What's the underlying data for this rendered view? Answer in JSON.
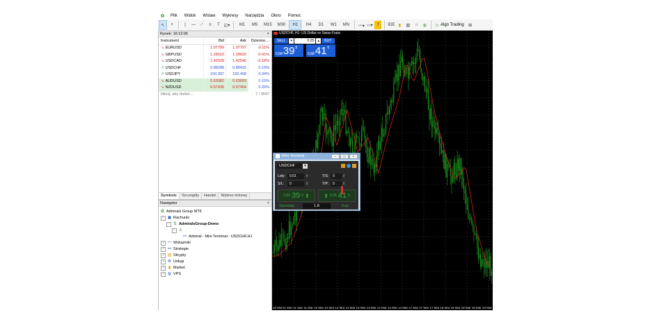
{
  "menu": [
    "Plik",
    "Widok",
    "Wstaw",
    "Wykresy",
    "Narzędzia",
    "Okno",
    "Pomoc"
  ],
  "toolbar": {
    "timeframes": [
      "M1",
      "M5",
      "M15",
      "M30",
      "H1",
      "H4",
      "D1",
      "W1",
      "MN"
    ],
    "active_timeframe": "H1",
    "algo_trading": "Algo Trading"
  },
  "market_watch": {
    "title": "Rynek: 16:12:06",
    "headers": [
      "Instrument",
      "Bid",
      "Ask",
      "Dzienna ..."
    ],
    "rows": [
      {
        "symbol": "EURUSD",
        "bid": "1.07789",
        "ask": "1.07797",
        "change": "-0.11%",
        "dir": "down"
      },
      {
        "symbol": "GBPUSD",
        "bid": "1.28910",
        "ask": "1.28920",
        "change": "-0.41%",
        "dir": "down"
      },
      {
        "symbol": "USDCAD",
        "bid": "1.42528",
        "ask": "1.42546",
        "change": "-0.18%",
        "dir": "down"
      },
      {
        "symbol": "USDCHF",
        "bid": "0.88398",
        "ask": "0.88416",
        "change": "0.19%",
        "dir": "up"
      },
      {
        "symbol": "USDJPY",
        "bid": "150.397",
        "ask": "150.408",
        "change": "0.34%",
        "dir": "up"
      },
      {
        "symbol": "AUDUSD",
        "bid": "0.63082",
        "ask": "0.63093",
        "change": "0.10%",
        "dir": "down"
      },
      {
        "symbol": "NZDUSD",
        "bid": "0.57435",
        "ask": "0.57454",
        "change": "0.20%",
        "dir": "down"
      }
    ],
    "add_label": "kliknij, aby dodać...",
    "count": "7 / 3597",
    "tabs": [
      "Symbole",
      "Szczegóły",
      "Handel",
      "Wykres tickowy"
    ]
  },
  "navigator": {
    "title": "Nawigator",
    "items": [
      "Admirals Group MT5",
      "Rachunki",
      "AdmiralsGroup-Demo",
      "Admiral - Mini Terminal - USDCHF,H1",
      "Wskaźniki",
      "Strategie",
      "Skrypty",
      "Usługi",
      "Market",
      "VPS"
    ]
  },
  "chart": {
    "title": "USDCHF, H1: US Dollar vs Swiss Franc",
    "sell_label": "SELL",
    "buy_label": "BUY",
    "lot": "0.25",
    "sell_prefix": "0.88",
    "sell_big": "39",
    "sell_sup": "8",
    "buy_prefix": "0.88",
    "buy_big": "41",
    "buy_sup": "6",
    "xaxis": [
      "10 Mar 2025",
      "11 Mar 02:00",
      "11 Mar 10:00",
      "11 Mar 18:00",
      "12 Mar 02:00",
      "12 Mar 10:00",
      "12 Mar 18:00",
      "13 Mar 02:00",
      "13 Mar 10:00",
      "13 Mar 18:00",
      "14 Mar 02:00",
      "14 Mar 10:00",
      "14 Mar 18:00",
      "17 Mar 02:00",
      "17 Mar 10:00",
      "17 Mar 18:00",
      "18 Mar 02:00",
      "18 Mar 10:00",
      "18 Mar 18:00",
      "19 Mar 02:00",
      "19 Mar 10:00"
    ]
  },
  "mini_terminal": {
    "title": "Mini Terminal",
    "symbol": "USDCHF",
    "lots_label": "Loty:",
    "lots_value": "0.01",
    "sl_label": "S/L:",
    "sl_value": "0",
    "ts_label": "T/S:",
    "ts_value": "0",
    "tp_label": "T/P:",
    "tp_value": "0",
    "sell_prefix": "0.88",
    "sell_big": "39",
    "sell_sup": "8",
    "buy_prefix": "0.88",
    "buy_big": "41",
    "buy_sup": "6",
    "sell_label": "Sprzedaj",
    "buy_label": "Kup",
    "spread": "1.8"
  }
}
